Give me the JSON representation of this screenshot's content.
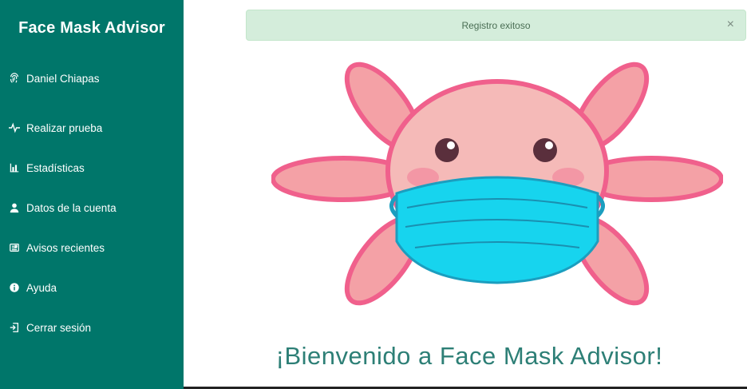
{
  "app": {
    "title": "Face Mask Advisor"
  },
  "user": {
    "name": "Daniel Chiapas",
    "icon": "fingerprint-icon"
  },
  "nav": {
    "items": [
      {
        "label": "Realizar prueba",
        "icon": "pulse-icon"
      },
      {
        "label": "Estadísticas",
        "icon": "bar-chart-icon"
      },
      {
        "label": "Datos de la cuenta",
        "icon": "user-icon"
      },
      {
        "label": "Avisos recientes",
        "icon": "newspaper-icon"
      },
      {
        "label": "Ayuda",
        "icon": "info-icon"
      },
      {
        "label": "Cerrar sesión",
        "icon": "sign-out-icon"
      }
    ]
  },
  "alert": {
    "message": "Registro exitoso",
    "close": "×"
  },
  "main": {
    "welcome": "¡Bienvenido a Face Mask Advisor!"
  },
  "colors": {
    "sidebar": "#00766a",
    "accent": "#2d7f76",
    "alert_bg": "#d4eddb",
    "mask": "#17d4ee",
    "axolotl_outline": "#f0608c"
  }
}
